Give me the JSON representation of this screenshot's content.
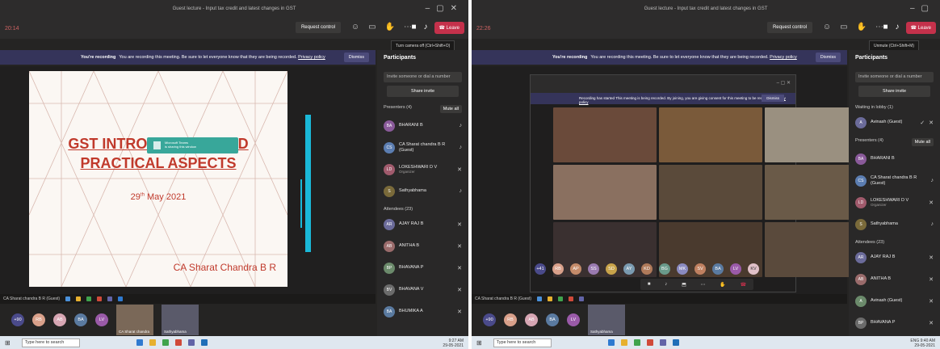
{
  "left": {
    "title": "Guest lecture - Input tax credit and latest changes in GST",
    "timer": "20:14",
    "request_control": "Request control",
    "leave": "Leave",
    "tooltip": "Turn camera off (Ctrl+Shift+O)",
    "banner_bold": "You're recording",
    "banner_text": "You are recording this meeting. Be sure to let everyone know that they are being recorded.",
    "banner_link": "Privacy policy",
    "dismiss": "Dismiss",
    "notif_line1": "Microsoft Teams",
    "notif_line2": "is sharing this window",
    "slide_title_1": "GST INTRODUCTION AND",
    "slide_title_2": "PRACTICAL ASPECTS",
    "slide_date_day": "29",
    "slide_date_sup": "th",
    "slide_date_rest": "May 2021",
    "slide_author": "CA Sharat Chandra B R",
    "presenter_label": "CA Sharat chandra B R (Guest)",
    "panel": {
      "title": "Participants",
      "invite_placeholder": "Invite someone or dial a number",
      "share_invite": "Share invite",
      "presenters_label": "Presenters (4)",
      "mute_all": "Mute all",
      "presenters": [
        {
          "initials": "BA",
          "name": "BHARANI B",
          "color": "#8a5a9a"
        },
        {
          "initials": "CS",
          "name": "CA Sharat chandra B R (Guest)",
          "color": "#5b7db1"
        },
        {
          "initials": "LD",
          "name": "LOKESHWARI D V",
          "role": "Organizer",
          "color": "#a05a6c"
        },
        {
          "initials": "S",
          "name": "Sathyabhama",
          "color": "#7a6a3a"
        }
      ],
      "attendees_label": "Attendees (23)",
      "attendees": [
        {
          "initials": "AR",
          "name": "AJAY RAJ B",
          "color": "#6b6b9a"
        },
        {
          "initials": "AB",
          "name": "ANITHA B",
          "color": "#9a6b6b"
        },
        {
          "initials": "BP",
          "name": "BHAVANA P",
          "color": "#6b8a6b"
        },
        {
          "initials": "BV",
          "name": "BHAVANA V",
          "color": "#6b6b6b"
        },
        {
          "initials": "BA",
          "name": "BHUMIKA A",
          "color": "#5a7aa0"
        }
      ]
    },
    "gallery": [
      {
        "initials": "+90",
        "color": "#4a4a8a"
      },
      {
        "initials": "RB",
        "color": "#d9a08a"
      },
      {
        "initials": "AB",
        "color": "#d7a6b3"
      },
      {
        "initials": "BA",
        "name": "BHUMIKA A",
        "color": "#5a7aa0"
      },
      {
        "initials": "LV",
        "name": "LOKESHWARI D V",
        "color": "#9a5aa8"
      }
    ],
    "gallery_tiles": [
      "CA Sharat chandra",
      "Sathyabhama"
    ]
  },
  "right": {
    "title": "Guest lecture - Input tax credit and latest changes in GST",
    "timer": "22:26",
    "request_control": "Request control",
    "leave": "Leave",
    "tooltip": "Unmute (Ctrl+Shift+M)",
    "banner_bold": "You're recording",
    "banner_text": "You are recording this meeting. Be sure to let everyone know that they are being recorded.",
    "banner_link": "Privacy policy",
    "dismiss": "Dismiss",
    "popup_rec": "Recording has started  This meeting is being recorded. By joining, you are giving consent for this meeting to be recorded.",
    "popup_link": "Privacy policy",
    "popup_dismiss": "Dismiss",
    "presenter_label": "CA Sharat chandra B R (Guest)",
    "tiles": [
      {
        "label": "",
        "color": "#6a4a3a"
      },
      {
        "label": "",
        "color": "#7a5a3a"
      },
      {
        "label": "",
        "color": "#9a9080"
      },
      {
        "label": "",
        "color": "#8a7060"
      },
      {
        "label": "",
        "color": "#5a4a3a"
      },
      {
        "label": "",
        "color": "#6a5a48"
      },
      {
        "label": "",
        "color": "#3a3030"
      },
      {
        "label": "",
        "color": "#4a3a2e"
      },
      {
        "label": "",
        "color": "#5a4a3c"
      }
    ],
    "avrow": [
      "+41",
      "RB",
      "AP",
      "SS",
      "SD",
      "AY",
      "KD",
      "BG",
      "MK",
      "SV",
      "BA",
      "LV",
      "KV"
    ],
    "avrow_colors": [
      "#4a4a8a",
      "#d9a08a",
      "#c48b6a",
      "#9a7ab0",
      "#c8a34a",
      "#7a9ab0",
      "#b07a5a",
      "#6a9a8a",
      "#8a8ac0",
      "#c08060",
      "#5a7aa0",
      "#9a5aa8",
      "#e0c0c8"
    ],
    "panel": {
      "title": "Participants",
      "invite_placeholder": "Invite someone or dial a number",
      "share_invite": "Share invite",
      "lobby_label": "Waiting in lobby (1)",
      "lobby": [
        {
          "initials": "A",
          "name": "Avinash (Guest)",
          "color": "#6b6b9a"
        }
      ],
      "presenters_label": "Presenters (4)",
      "mute_all": "Mute all",
      "presenters": [
        {
          "initials": "BA",
          "name": "BHARANI B",
          "color": "#8a5a9a"
        },
        {
          "initials": "CS",
          "name": "CA Sharat chandra B R (Guest)",
          "color": "#5b7db1"
        },
        {
          "initials": "LD",
          "name": "LOKESHWARI D V",
          "role": "Organizer",
          "color": "#a05a6c"
        },
        {
          "initials": "S",
          "name": "Sathyabhama",
          "color": "#7a6a3a"
        }
      ],
      "attendees_label": "Attendees (23)",
      "attendees": [
        {
          "initials": "AR",
          "name": "AJAY RAJ B",
          "color": "#6b6b9a"
        },
        {
          "initials": "AB",
          "name": "ANITHA B",
          "color": "#9a6b6b"
        },
        {
          "initials": "A",
          "name": "Avinash (Guest)",
          "color": "#6b8a6b"
        },
        {
          "initials": "BP",
          "name": "BHAVANA P",
          "color": "#6b6b6b"
        }
      ]
    },
    "gallery": [
      {
        "initials": "+90",
        "color": "#4a4a8a"
      },
      {
        "initials": "RB",
        "color": "#d9a08a"
      },
      {
        "initials": "AB",
        "color": "#d7a6b3"
      },
      {
        "initials": "BA",
        "name": "BHUMIKA A",
        "color": "#5a7aa0"
      },
      {
        "initials": "LV",
        "name": "LOKESHWARI D V",
        "color": "#9a5aa8"
      }
    ],
    "gallery_tiles": [
      "Sathyabhama"
    ]
  },
  "taskbar": {
    "search": "Type here to search",
    "left_time": "9:27 AM",
    "left_date": "29-05-2021",
    "right_time": "9:40 AM",
    "right_date": "29-05-2021",
    "lang": "ENG"
  },
  "colors": {
    "leave": "#c4314b",
    "accent": "#6264a7",
    "banner": "#35345a",
    "slide_red": "#c0392b",
    "cyan": "#1ab8d8"
  }
}
